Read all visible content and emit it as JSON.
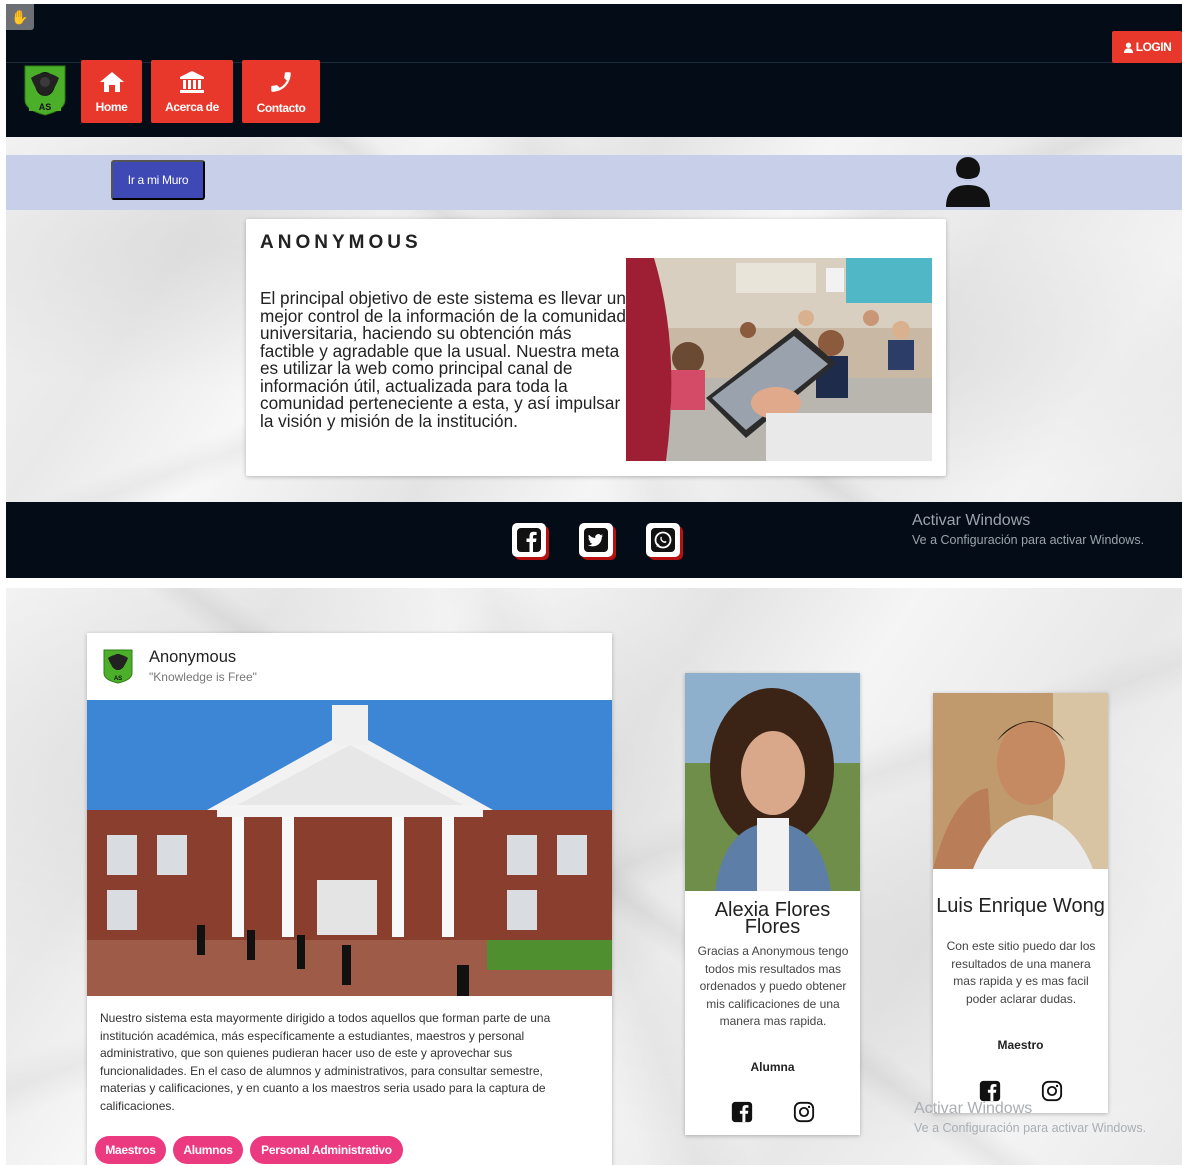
{
  "header": {
    "login_label": "LOGIN",
    "logo_text": "AS",
    "nav": [
      {
        "label": "Home",
        "icon": "home-icon"
      },
      {
        "label": "Acerca de",
        "icon": "bank-icon"
      },
      {
        "label": "Contacto",
        "icon": "phone-icon"
      }
    ]
  },
  "muro": {
    "button_label": "Ir a mi Muro"
  },
  "about": {
    "title": "ANONYMOUS",
    "text": "El principal objetivo de este sistema es llevar un mejor control de la información de la comunidad universitaria, haciendo su obtención más factible y agradable que la usual. Nuestra meta es utilizar la web como principal canal de información útil, actualizada para toda la comunidad perteneciente a esta, y así impulsar la visión y misión de la institución."
  },
  "footer": {
    "social": [
      "facebook-icon",
      "twitter-icon",
      "whatsapp-icon"
    ]
  },
  "watermark": {
    "title": "Activar Windows",
    "subtitle": "Ve a Configuración para activar Windows."
  },
  "post": {
    "name": "Anonymous",
    "subtitle": "\"Knowledge is Free\"",
    "text": "Nuestro sistema esta mayormente dirigido a todos aquellos que forman parte de una institución académica, más específicamente a estudiantes, maestros y personal administrativo, que son quienes pudieran hacer uso de este y aprovechar sus funcionalidades. En el caso de alumnos y administrativos, para consultar semestre, materias y calificaciones, y en cuanto a los maestros seria usado para la captura de calificaciones.",
    "tags": [
      "Maestros",
      "Alumnos",
      "Personal Administrativo"
    ]
  },
  "testimonials": [
    {
      "name": "Alexia Flores Flores",
      "quote": "Gracias a Anonymous tengo todos mis resultados mas ordenados y puedo obtener mis calificaciones de una manera mas rapida.",
      "role": "Alumna"
    },
    {
      "name": "Luis Enrique Wong",
      "quote": "Con este sitio puedo dar los resultados de una manera mas rapida y es mas facil poder aclarar dudas.",
      "role": "Maestro"
    }
  ],
  "colors": {
    "header_bg": "#030c17",
    "accent_red": "#e8382b",
    "muro_band": "#c8cfe9",
    "muro_button": "#3f49b5",
    "tag_pink": "#ec3a81"
  }
}
